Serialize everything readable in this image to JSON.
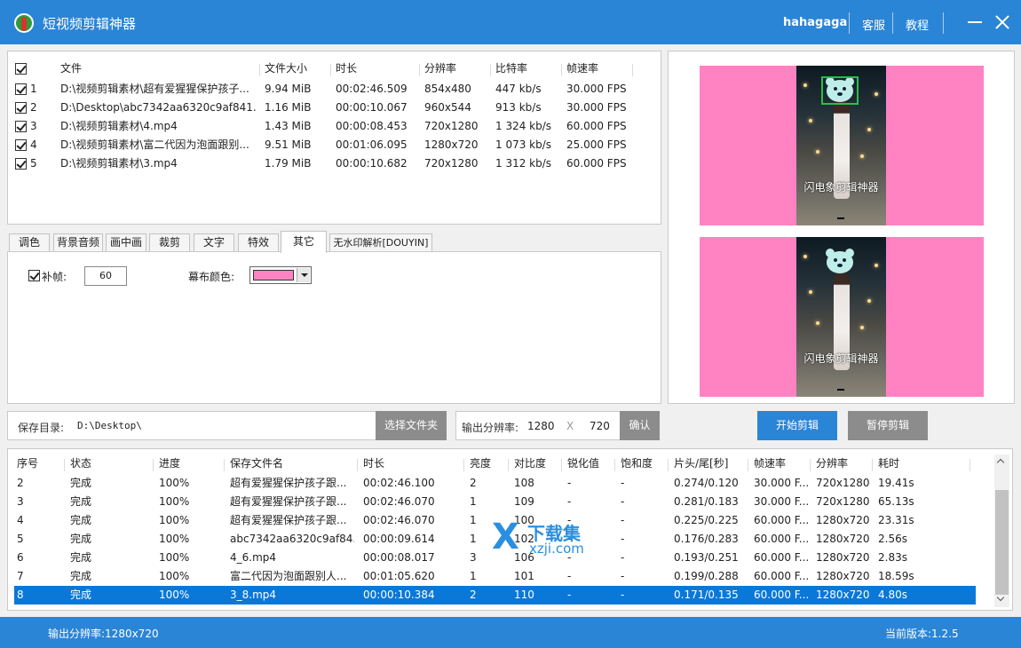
{
  "app": {
    "title": "短视频剪辑神器",
    "user": "hahagaga",
    "service_label": "客服",
    "tutorial_label": "教程"
  },
  "file_table": {
    "headers": [
      "文件",
      "文件大小",
      "时长",
      "分辨率",
      "比特率",
      "帧速率"
    ],
    "rows": [
      {
        "index": "1",
        "file": "D:\\视频剪辑素材\\超有爱猩猩保护孩子...",
        "size": "9.94 MiB",
        "duration": "00:02:46.509",
        "resolution": "854x480",
        "bitrate": "447 kb/s",
        "fps": "30.000 FPS"
      },
      {
        "index": "2",
        "file": "D:\\Desktop\\abc7342aa6320c9af841...",
        "size": "1.16 MiB",
        "duration": "00:00:10.067",
        "resolution": "960x544",
        "bitrate": "913 kb/s",
        "fps": "30.000 FPS"
      },
      {
        "index": "3",
        "file": "D:\\视频剪辑素材\\4.mp4",
        "size": "1.43 MiB",
        "duration": "00:00:08.453",
        "resolution": "720x1280",
        "bitrate": "1 324 kb/s",
        "fps": "60.000 FPS"
      },
      {
        "index": "4",
        "file": "D:\\视频剪辑素材\\富二代因为泡面跟别...",
        "size": "9.51 MiB",
        "duration": "00:01:06.095",
        "resolution": "1280x720",
        "bitrate": "1 073 kb/s",
        "fps": "25.000 FPS"
      },
      {
        "index": "5",
        "file": "D:\\视频剪辑素材\\3.mp4",
        "size": "1.79 MiB",
        "duration": "00:00:10.682",
        "resolution": "720x1280",
        "bitrate": "1 312 kb/s",
        "fps": "60.000 FPS"
      }
    ]
  },
  "preview": {
    "caption": "闪电象剪辑神器",
    "background_color": "#ff82c3"
  },
  "tabs": [
    "调色",
    "背景音频",
    "画中画",
    "裁剪",
    "文字",
    "特效",
    "其它",
    "无水印解析[DOUYIN]"
  ],
  "active_tab": "其它",
  "other_tab": {
    "fill_frame_label": "补帧:",
    "fill_frame_value": "60",
    "canvas_color_label": "幕布颜色:",
    "canvas_color": "#ff82c3"
  },
  "save": {
    "label": "保存目录:",
    "path": "D:\\Desktop\\",
    "choose_button": "选择文件夹"
  },
  "output_resolution": {
    "label": "输出分辨率:",
    "width": "1280",
    "separator": "X",
    "height": "720",
    "confirm_button": "确认"
  },
  "actions": {
    "start": "开始剪辑",
    "pause": "暂停剪辑"
  },
  "task_table": {
    "headers": [
      "序号",
      "状态",
      "进度",
      "保存文件名",
      "时长",
      "亮度",
      "对比度",
      "锐化值",
      "饱和度",
      "片头/尾[秒]",
      "帧速率",
      "分辨率",
      "耗时"
    ],
    "rows": [
      [
        "2",
        "完成",
        "100%",
        "超有爱猩猩保护孩子跟...",
        "00:02:46.100",
        "2",
        "108",
        "-",
        "-",
        "0.274/0.120",
        "30.000 F...",
        "720x1280",
        "19.41s"
      ],
      [
        "3",
        "完成",
        "100%",
        "超有爱猩猩保护孩子跟...",
        "00:02:46.070",
        "1",
        "109",
        "-",
        "-",
        "0.281/0.183",
        "30.000 F...",
        "720x1280",
        "65.13s"
      ],
      [
        "4",
        "完成",
        "100%",
        "超有爱猩猩保护孩子跟...",
        "00:02:46.070",
        "1",
        "100",
        "-",
        "-",
        "0.225/0.225",
        "60.000 F...",
        "1280x720",
        "23.31s"
      ],
      [
        "5",
        "完成",
        "100%",
        "abc7342aa6320c9af84...",
        "00:00:09.614",
        "1",
        "102",
        "-",
        "-",
        "0.176/0.283",
        "60.000 F...",
        "1280x720",
        "2.56s"
      ],
      [
        "6",
        "完成",
        "100%",
        "4_6.mp4",
        "00:00:08.017",
        "3",
        "106",
        "-",
        "-",
        "0.193/0.251",
        "60.000 F...",
        "1280x720",
        "2.83s"
      ],
      [
        "7",
        "完成",
        "100%",
        "富二代因为泡面跟别人...",
        "00:01:05.620",
        "1",
        "101",
        "-",
        "-",
        "0.199/0.288",
        "60.000 F...",
        "1280x720",
        "18.59s"
      ],
      [
        "8",
        "完成",
        "100%",
        "3_8.mp4",
        "00:00:10.384",
        "2",
        "110",
        "-",
        "-",
        "0.171/0.135",
        "60.000 F...",
        "1280x720",
        "4.80s"
      ]
    ],
    "selected_index": 6
  },
  "watermark": {
    "mark": "X",
    "name": "下载集",
    "url": "xzji.com"
  },
  "status": {
    "left": "输出分辨率:1280x720",
    "right": "当前版本:1.2.5"
  },
  "colors": {
    "accent": "#2a85d6",
    "selection": "#0a78d7",
    "button_gray": "#8c8c8c"
  }
}
